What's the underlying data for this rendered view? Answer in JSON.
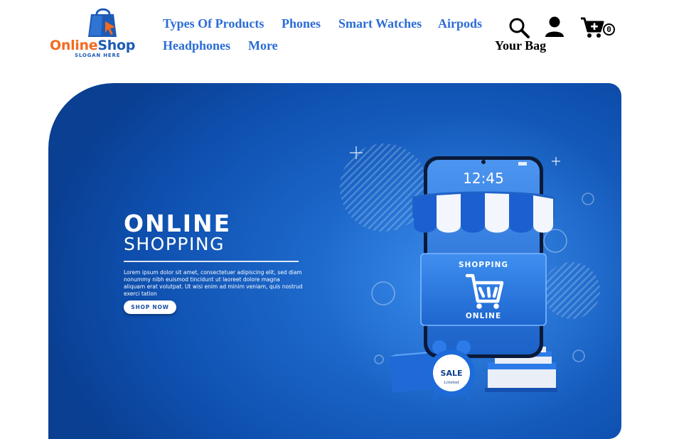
{
  "brand": {
    "name_part1": "Online",
    "name_part2": "Shop",
    "slogan": "SLOGAN HERE"
  },
  "nav": {
    "items": [
      {
        "label": "Types Of Products"
      },
      {
        "label": "Phones"
      },
      {
        "label": "Smart Watches"
      },
      {
        "label": "Airpods"
      },
      {
        "label": "Headphones"
      },
      {
        "label": "More"
      }
    ]
  },
  "header_icons": {
    "search": "search-icon",
    "user": "user-icon",
    "cart": "cart-add-icon",
    "cart_count": "0",
    "bag_label": "Your Bag"
  },
  "hero": {
    "title_line1": "ONLINE",
    "title_line2": "SHOPPING",
    "body": "Lorem ipsum dolor sit amet, consectetuer adipiscing elit, sed diam nonummy nibh euismod tincidunt ut laoreet dolore magna aliquam erat volutpat. Ut wisi enim ad minim veniam, quis nostrud exerci tation",
    "cta": "SHOP NOW",
    "phone_time": "12:45",
    "sign_line1": "SHOPPING",
    "sign_line2": "ONLINE",
    "clock_label": "SALE",
    "clock_sub": "Limited"
  },
  "colors": {
    "brand_orange": "#f26b21",
    "brand_blue": "#1d5bb5",
    "nav_link": "#2b6cd6",
    "hero_blue": "#1a64c6"
  }
}
